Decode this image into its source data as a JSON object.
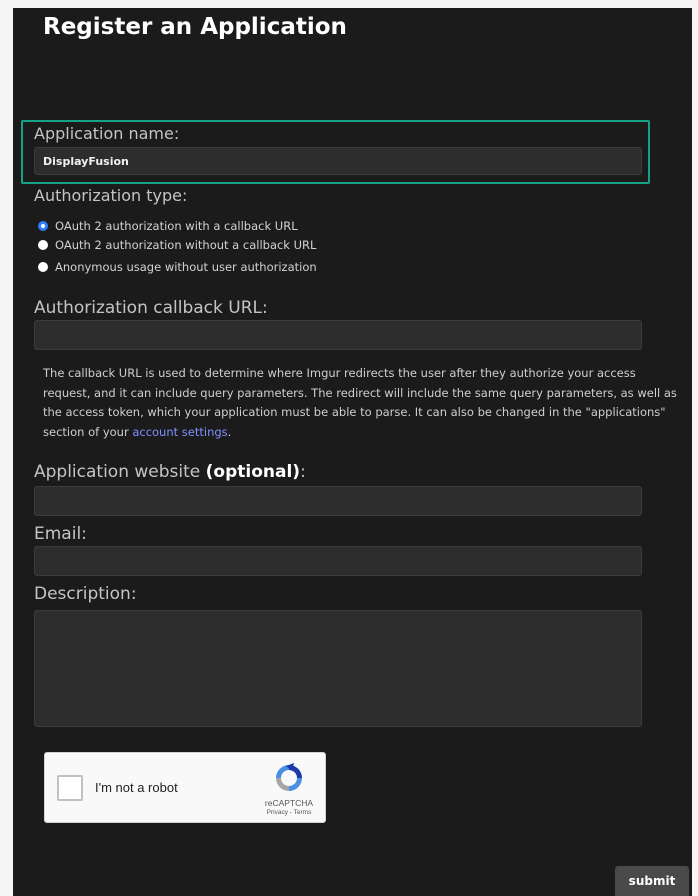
{
  "page": {
    "title": "Register an Application"
  },
  "app_name": {
    "label": "Application name:",
    "value": "DisplayFusion"
  },
  "auth_type": {
    "label": "Authorization type:",
    "selected_index": 0,
    "options": [
      "OAuth 2 authorization with a callback URL",
      "OAuth 2 authorization without a callback URL",
      "Anonymous usage without user authorization"
    ]
  },
  "callback": {
    "label": "Authorization callback URL:",
    "value": "",
    "help_text": "The callback URL is used to determine where Imgur redirects the user after they authorize your access request, and it can include query parameters. The redirect will include the same query parameters, as well as the access token, which your application must be able to parse. It can also be changed in the \"applications\" section of your ",
    "help_link": "account settings",
    "help_end": "."
  },
  "website": {
    "label": "Application website ",
    "optional": "(optional)",
    "colon": ":",
    "value": ""
  },
  "email": {
    "label": "Email:",
    "value": ""
  },
  "description": {
    "label": "Description:",
    "value": ""
  },
  "captcha": {
    "label": "I'm not a robot",
    "brand": "reCAPTCHA",
    "links": "Privacy - Terms"
  },
  "submit": {
    "label": "submit"
  },
  "colors": {
    "highlight": "#16a085",
    "link": "#7f90ff",
    "radio_checked": "#2d7ff9",
    "background": "#1b1b1b"
  }
}
